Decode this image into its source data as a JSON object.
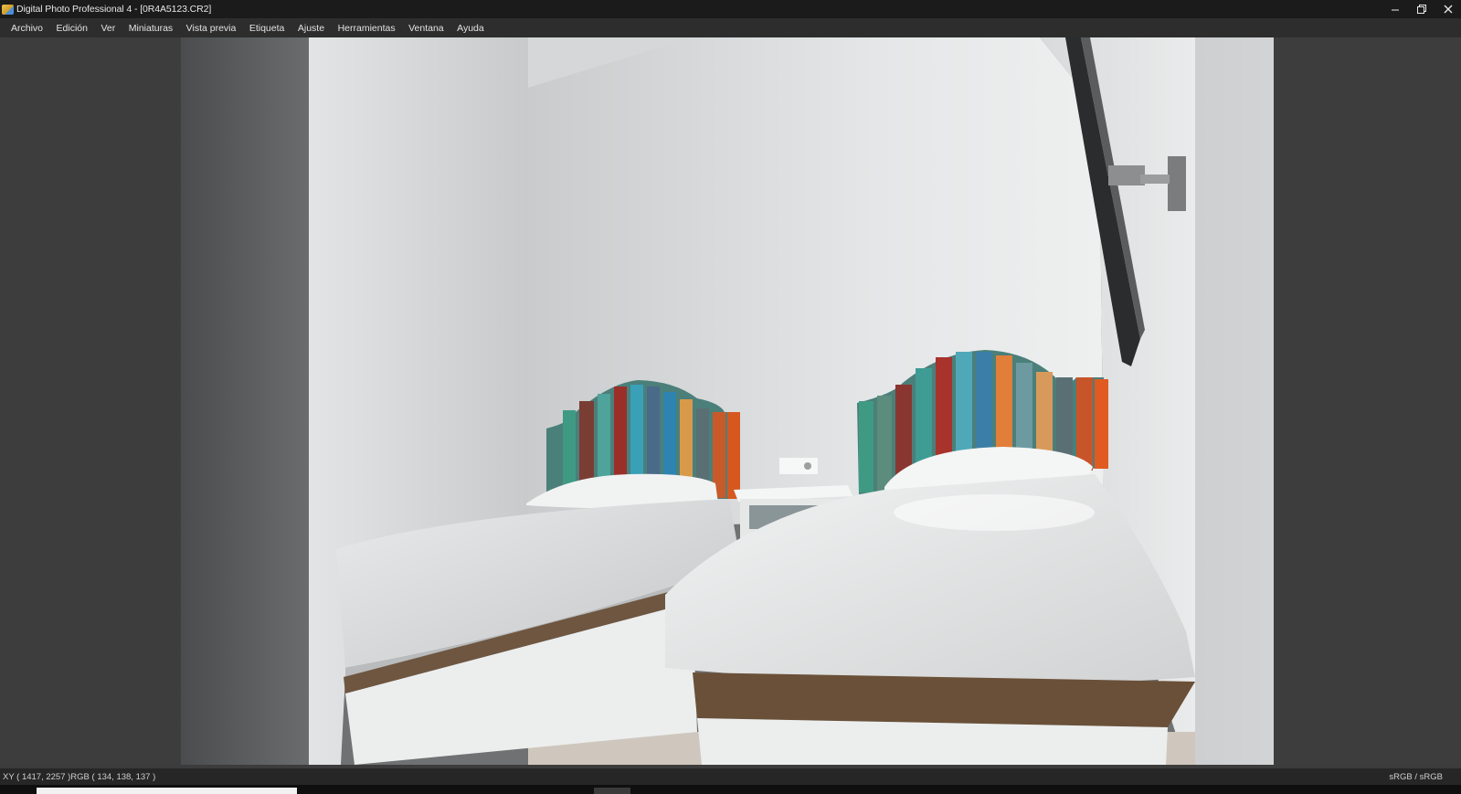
{
  "window": {
    "title": "Digital Photo Professional 4 - [0R4A5123.CR2]",
    "controls": {
      "minimize_icon": "minimize-icon",
      "restore_icon": "restore-icon",
      "close_icon": "close-icon"
    }
  },
  "menu": {
    "items": [
      {
        "label": "Archivo"
      },
      {
        "label": "Edición"
      },
      {
        "label": "Ver"
      },
      {
        "label": "Miniaturas"
      },
      {
        "label": "Vista previa"
      },
      {
        "label": "Etiqueta"
      },
      {
        "label": "Ajuste"
      },
      {
        "label": "Herramientas"
      },
      {
        "label": "Ventana"
      },
      {
        "label": "Ayuda"
      }
    ]
  },
  "preview": {
    "subject": "photo of a bedroom with two single beds, colorful wooden headboards and a small nightstand"
  },
  "status": {
    "readout": "XY ( 1417, 2257 )RGB ( 134, 138, 137 )",
    "color_space": "sRGB / sRGB"
  },
  "colors": {
    "titlebar_bg": "#1b1b1b",
    "menubar_bg": "#2d2d2d",
    "viewer_bg": "#3d3d3d",
    "statusbar_bg": "#262626"
  }
}
